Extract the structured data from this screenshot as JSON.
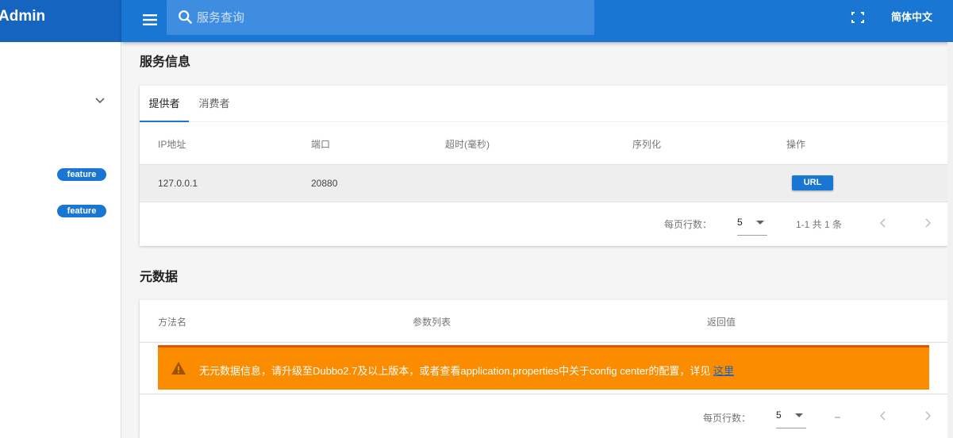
{
  "sidebar": {
    "brand": "Admin",
    "badges": [
      "feature",
      "feature"
    ]
  },
  "topbar": {
    "search_placeholder": "服务查询",
    "language": "简体中文"
  },
  "service_info": {
    "title": "服务信息",
    "tabs": [
      "提供者",
      "消费者"
    ],
    "columns": [
      "IP地址",
      "端口",
      "超时(毫秒)",
      "序列化",
      "操作"
    ],
    "rows": [
      {
        "ip": "127.0.0.1",
        "port": "20880",
        "timeout": "",
        "serialization": "",
        "action": "URL"
      }
    ],
    "pager": {
      "rows_per_page_label": "每页行数：",
      "rows_per_page": "5",
      "range": "1-1 共 1 条"
    }
  },
  "metadata": {
    "title": "元数据",
    "columns": [
      "方法名",
      "参数列表",
      "返回值"
    ],
    "alert_text": "无元数据信息，请升级至Dubbo2.7及以上版本，或者查看application.properties中关于config center的配置，详见",
    "alert_link": "这里",
    "pager": {
      "rows_per_page_label": "每页行数：",
      "rows_per_page": "5",
      "range": "–"
    }
  }
}
